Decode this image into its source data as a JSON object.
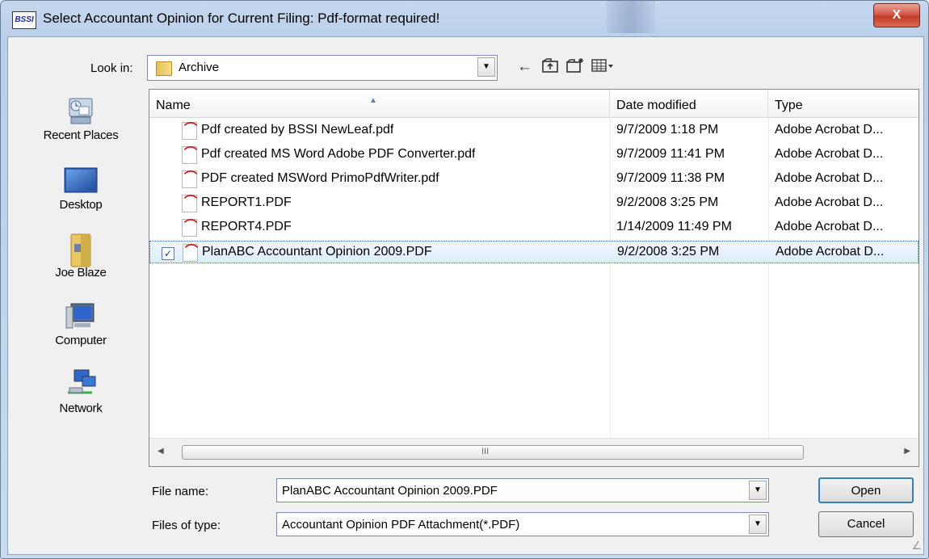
{
  "window": {
    "title": "Select Accountant Opinion for Current Filing: Pdf-format required!",
    "logo_text": "BSSI",
    "close_label": "X"
  },
  "lookin": {
    "label": "Look in:",
    "value": "Archive"
  },
  "places": [
    {
      "label": "Recent Places",
      "icon": "recent-places-icon"
    },
    {
      "label": "Desktop",
      "icon": "desktop-icon"
    },
    {
      "label": "Joe Blaze",
      "icon": "user-folder-icon"
    },
    {
      "label": "Computer",
      "icon": "computer-icon"
    },
    {
      "label": "Network",
      "icon": "network-icon"
    }
  ],
  "columns": {
    "name": "Name",
    "date": "Date modified",
    "type": "Type"
  },
  "files": [
    {
      "name": "Pdf created by BSSI NewLeaf.pdf",
      "date": "9/7/2009 1:18 PM",
      "type": "Adobe Acrobat D..."
    },
    {
      "name": "Pdf created MS Word Adobe PDF Converter.pdf",
      "date": "9/7/2009 11:41 PM",
      "type": "Adobe Acrobat D..."
    },
    {
      "name": "PDF created MSWord PrimoPdfWriter.pdf",
      "date": "9/7/2009 11:38 PM",
      "type": "Adobe Acrobat D..."
    },
    {
      "name": "REPORT1.PDF",
      "date": "9/2/2008 3:25 PM",
      "type": "Adobe Acrobat D..."
    },
    {
      "name": "REPORT4.PDF",
      "date": "1/14/2009 11:49 PM",
      "type": "Adobe Acrobat D..."
    },
    {
      "name": "PlanABC Accountant Opinion 2009.PDF",
      "date": "9/2/2008 3:25 PM",
      "type": "Adobe Acrobat D...",
      "selected": true
    }
  ],
  "scroll": {
    "grip": "III"
  },
  "filename": {
    "label": "File name:",
    "value": "PlanABC Accountant Opinion 2009.PDF"
  },
  "filetype": {
    "label": "Files of type:",
    "value": "Accountant Opinion PDF Attachment(*.PDF)"
  },
  "buttons": {
    "open": "Open",
    "cancel": "Cancel"
  }
}
